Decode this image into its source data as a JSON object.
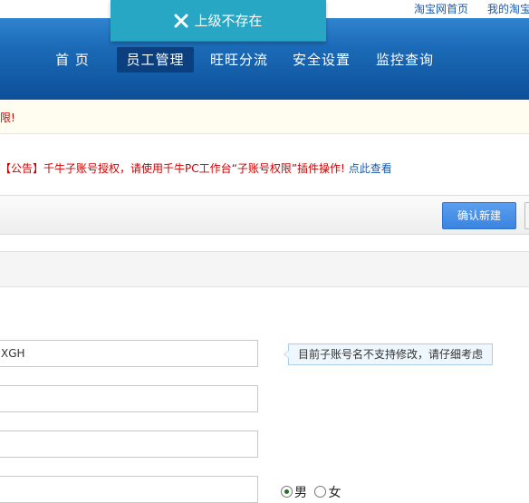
{
  "toplinks": {
    "taobao_home": "淘宝网首页",
    "my_taobao": "我的淘宝"
  },
  "toast": {
    "icon": "close-icon",
    "message": "上级不存在"
  },
  "nav": {
    "items": [
      {
        "label": "首 页",
        "active": false
      },
      {
        "label": "员工管理",
        "active": true
      },
      {
        "label": "旺旺分流",
        "active": false
      },
      {
        "label": "安全设置",
        "active": false
      },
      {
        "label": "监控查询",
        "active": false
      }
    ]
  },
  "notice1": {
    "text": "限!"
  },
  "notice2": {
    "red_text": "【公告】千牛子账号授权，请使用千牛PC工作台“子账号权限”插件操作!",
    "link_text": "点此查看"
  },
  "toolbar": {
    "confirm_label": "确认新建"
  },
  "form": {
    "account_value": "XGH",
    "account_tip": "目前子账号名不支持修改，请仔细考虑",
    "field2_value": "",
    "field3_value": "",
    "field4_value": "",
    "gender": {
      "male_label": "男",
      "female_label": "女",
      "selected": "male"
    }
  },
  "colors": {
    "header_blue": "#1c6bb8",
    "toast_teal": "#27a7c4",
    "button_blue": "#3a84e0",
    "notice_red": "#cc0000",
    "link_blue": "#1a5aa8"
  }
}
